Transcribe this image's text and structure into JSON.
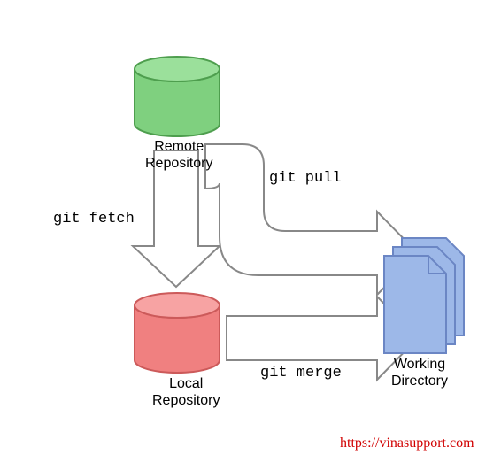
{
  "diagram": {
    "remote_label_line1": "Remote",
    "remote_label_line2": "Repository",
    "local_label_line1": "Local",
    "local_label_line2": "Repository",
    "working_label_line1": "Working",
    "working_label_line2": "Directory",
    "cmd_fetch": "git fetch",
    "cmd_pull": "git pull",
    "cmd_merge": "git merge"
  },
  "watermark": "https://vinasupport.com",
  "colors": {
    "remote_fill": "#7fd07f",
    "remote_stroke": "#4e9e4e",
    "local_fill": "#f08080",
    "local_stroke": "#cc5a5a",
    "paper_fill": "#9db8e8",
    "paper_stroke": "#6b86c4",
    "arrow_fill": "#ffffff",
    "arrow_stroke": "#888888"
  }
}
